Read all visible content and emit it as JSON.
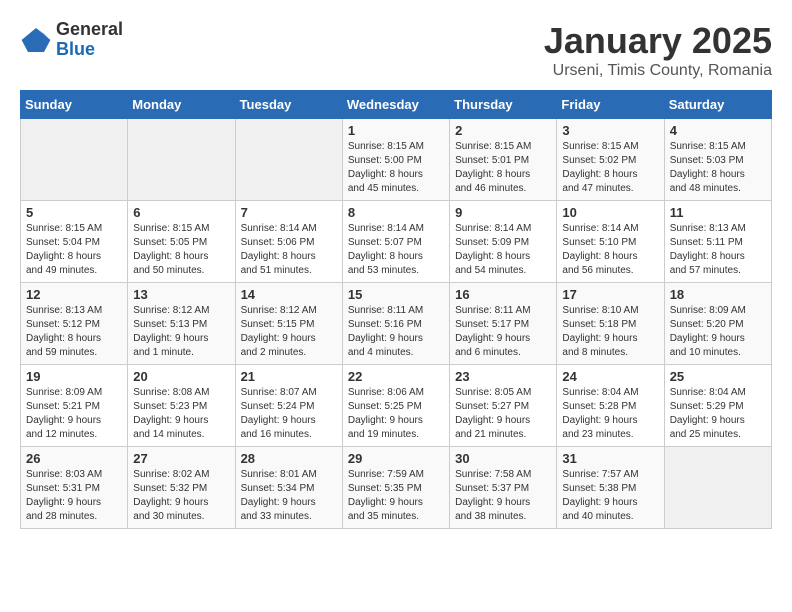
{
  "logo": {
    "general": "General",
    "blue": "Blue"
  },
  "title": "January 2025",
  "subtitle": "Urseni, Timis County, Romania",
  "weekdays": [
    "Sunday",
    "Monday",
    "Tuesday",
    "Wednesday",
    "Thursday",
    "Friday",
    "Saturday"
  ],
  "weeks": [
    [
      {
        "day": "",
        "info": ""
      },
      {
        "day": "",
        "info": ""
      },
      {
        "day": "",
        "info": ""
      },
      {
        "day": "1",
        "info": "Sunrise: 8:15 AM\nSunset: 5:00 PM\nDaylight: 8 hours\nand 45 minutes."
      },
      {
        "day": "2",
        "info": "Sunrise: 8:15 AM\nSunset: 5:01 PM\nDaylight: 8 hours\nand 46 minutes."
      },
      {
        "day": "3",
        "info": "Sunrise: 8:15 AM\nSunset: 5:02 PM\nDaylight: 8 hours\nand 47 minutes."
      },
      {
        "day": "4",
        "info": "Sunrise: 8:15 AM\nSunset: 5:03 PM\nDaylight: 8 hours\nand 48 minutes."
      }
    ],
    [
      {
        "day": "5",
        "info": "Sunrise: 8:15 AM\nSunset: 5:04 PM\nDaylight: 8 hours\nand 49 minutes."
      },
      {
        "day": "6",
        "info": "Sunrise: 8:15 AM\nSunset: 5:05 PM\nDaylight: 8 hours\nand 50 minutes."
      },
      {
        "day": "7",
        "info": "Sunrise: 8:14 AM\nSunset: 5:06 PM\nDaylight: 8 hours\nand 51 minutes."
      },
      {
        "day": "8",
        "info": "Sunrise: 8:14 AM\nSunset: 5:07 PM\nDaylight: 8 hours\nand 53 minutes."
      },
      {
        "day": "9",
        "info": "Sunrise: 8:14 AM\nSunset: 5:09 PM\nDaylight: 8 hours\nand 54 minutes."
      },
      {
        "day": "10",
        "info": "Sunrise: 8:14 AM\nSunset: 5:10 PM\nDaylight: 8 hours\nand 56 minutes."
      },
      {
        "day": "11",
        "info": "Sunrise: 8:13 AM\nSunset: 5:11 PM\nDaylight: 8 hours\nand 57 minutes."
      }
    ],
    [
      {
        "day": "12",
        "info": "Sunrise: 8:13 AM\nSunset: 5:12 PM\nDaylight: 8 hours\nand 59 minutes."
      },
      {
        "day": "13",
        "info": "Sunrise: 8:12 AM\nSunset: 5:13 PM\nDaylight: 9 hours\nand 1 minute."
      },
      {
        "day": "14",
        "info": "Sunrise: 8:12 AM\nSunset: 5:15 PM\nDaylight: 9 hours\nand 2 minutes."
      },
      {
        "day": "15",
        "info": "Sunrise: 8:11 AM\nSunset: 5:16 PM\nDaylight: 9 hours\nand 4 minutes."
      },
      {
        "day": "16",
        "info": "Sunrise: 8:11 AM\nSunset: 5:17 PM\nDaylight: 9 hours\nand 6 minutes."
      },
      {
        "day": "17",
        "info": "Sunrise: 8:10 AM\nSunset: 5:18 PM\nDaylight: 9 hours\nand 8 minutes."
      },
      {
        "day": "18",
        "info": "Sunrise: 8:09 AM\nSunset: 5:20 PM\nDaylight: 9 hours\nand 10 minutes."
      }
    ],
    [
      {
        "day": "19",
        "info": "Sunrise: 8:09 AM\nSunset: 5:21 PM\nDaylight: 9 hours\nand 12 minutes."
      },
      {
        "day": "20",
        "info": "Sunrise: 8:08 AM\nSunset: 5:23 PM\nDaylight: 9 hours\nand 14 minutes."
      },
      {
        "day": "21",
        "info": "Sunrise: 8:07 AM\nSunset: 5:24 PM\nDaylight: 9 hours\nand 16 minutes."
      },
      {
        "day": "22",
        "info": "Sunrise: 8:06 AM\nSunset: 5:25 PM\nDaylight: 9 hours\nand 19 minutes."
      },
      {
        "day": "23",
        "info": "Sunrise: 8:05 AM\nSunset: 5:27 PM\nDaylight: 9 hours\nand 21 minutes."
      },
      {
        "day": "24",
        "info": "Sunrise: 8:04 AM\nSunset: 5:28 PM\nDaylight: 9 hours\nand 23 minutes."
      },
      {
        "day": "25",
        "info": "Sunrise: 8:04 AM\nSunset: 5:29 PM\nDaylight: 9 hours\nand 25 minutes."
      }
    ],
    [
      {
        "day": "26",
        "info": "Sunrise: 8:03 AM\nSunset: 5:31 PM\nDaylight: 9 hours\nand 28 minutes."
      },
      {
        "day": "27",
        "info": "Sunrise: 8:02 AM\nSunset: 5:32 PM\nDaylight: 9 hours\nand 30 minutes."
      },
      {
        "day": "28",
        "info": "Sunrise: 8:01 AM\nSunset: 5:34 PM\nDaylight: 9 hours\nand 33 minutes."
      },
      {
        "day": "29",
        "info": "Sunrise: 7:59 AM\nSunset: 5:35 PM\nDaylight: 9 hours\nand 35 minutes."
      },
      {
        "day": "30",
        "info": "Sunrise: 7:58 AM\nSunset: 5:37 PM\nDaylight: 9 hours\nand 38 minutes."
      },
      {
        "day": "31",
        "info": "Sunrise: 7:57 AM\nSunset: 5:38 PM\nDaylight: 9 hours\nand 40 minutes."
      },
      {
        "day": "",
        "info": ""
      }
    ]
  ]
}
